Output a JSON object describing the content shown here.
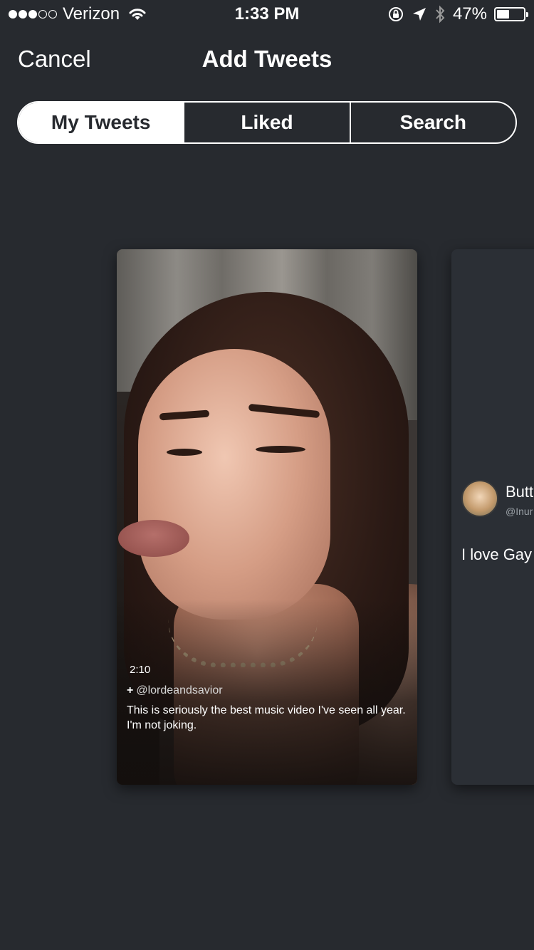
{
  "status_bar": {
    "carrier": "Verizon",
    "time": "1:33 PM",
    "battery_percent": "47%",
    "battery_level": 0.47,
    "signal_bars_filled": 3,
    "signal_bars_total": 5,
    "icons": [
      "wifi-icon",
      "rotation-lock-icon",
      "location-arrow-icon",
      "bluetooth-icon",
      "battery-icon"
    ]
  },
  "nav": {
    "cancel_label": "Cancel",
    "title": "Add Tweets"
  },
  "tabs": [
    {
      "label": "My Tweets",
      "active": true
    },
    {
      "label": "Liked",
      "active": false
    },
    {
      "label": "Search",
      "active": false
    }
  ],
  "cards": {
    "main": {
      "duration": "2:10",
      "handle": "@lordeandsavior",
      "plus": "+",
      "text": "This is seriously the best music video I've seen all year. I'm not joking."
    },
    "peek": {
      "name": "Butt",
      "handle": "@Inur",
      "text": "I love Gay"
    }
  },
  "colors": {
    "background": "#272a2f",
    "text": "#ffffff",
    "card_dark": "#2b2f35"
  }
}
